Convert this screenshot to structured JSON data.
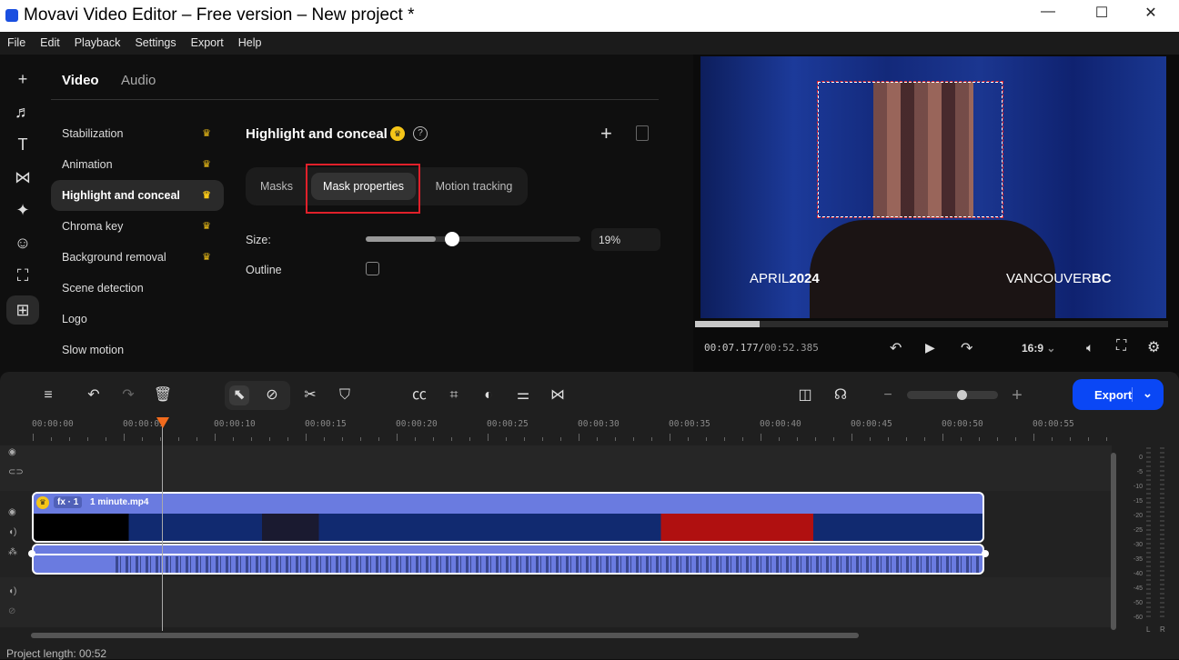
{
  "window": {
    "title": "Movavi Video Editor – Free version – New project *",
    "minimize": "—",
    "maximize": "☐",
    "close": "✕"
  },
  "menu": [
    "File",
    "Edit",
    "Playback",
    "Settings",
    "Export",
    "Help"
  ],
  "rail": [
    {
      "icon": "plus-icon",
      "g": "+"
    },
    {
      "icon": "music-icon",
      "g": "♬"
    },
    {
      "icon": "text-icon",
      "g": "T"
    },
    {
      "icon": "transitions-icon",
      "g": "⋈"
    },
    {
      "icon": "sparkle-icon",
      "g": "✦"
    },
    {
      "icon": "sticker-icon",
      "g": "☺"
    },
    {
      "icon": "store-icon",
      "g": "⛶"
    },
    {
      "icon": "more-tools-icon",
      "g": "⊞"
    }
  ],
  "tabs": {
    "video": "Video",
    "audio": "Audio"
  },
  "features": [
    {
      "label": "Stabilization",
      "premium": true
    },
    {
      "label": "Animation",
      "premium": true
    },
    {
      "label": "Highlight and conceal",
      "premium": true,
      "selected": true
    },
    {
      "label": "Chroma key",
      "premium": true
    },
    {
      "label": "Background removal",
      "premium": true
    },
    {
      "label": "Scene detection",
      "premium": false
    },
    {
      "label": "Logo",
      "premium": false
    },
    {
      "label": "Slow motion",
      "premium": false
    }
  ],
  "panel": {
    "title": "Highlight and conceal",
    "subtabs": [
      "Masks",
      "Mask properties",
      "Motion tracking"
    ],
    "active_subtab": "Mask properties",
    "size_label": "Size:",
    "size_value": "19%",
    "size_percent": 19,
    "outline_label": "Outline",
    "outline_checked": false,
    "highlight_color": "#e0202a"
  },
  "preview": {
    "left_caption_a": "APRIL",
    "left_caption_b": "2024",
    "right_caption_a": "VANCOUVER",
    "right_caption_b": "BC",
    "time_current": "00:07.177",
    "time_total": "00:52.385",
    "progress_fraction": 0.137,
    "aspect": "16:9"
  },
  "timeline": {
    "export_label": "Export",
    "ticks": [
      "00:00:00",
      "00:00:05",
      "00:00:10",
      "00:00:15",
      "00:00:20",
      "00:00:25",
      "00:00:30",
      "00:00:35",
      "00:00:40",
      "00:00:45",
      "00:00:50",
      "00:00:55"
    ],
    "clip_fx": "fx · 1",
    "clip_name": "1 minute.mp4",
    "project_length": "Project length: 00:52",
    "meter": [
      "0",
      "-5",
      "-10",
      "-15",
      "-20",
      "-25",
      "-30",
      "-35",
      "-40",
      "-45",
      "-50",
      "-60"
    ],
    "meter_lr": [
      "L",
      "R"
    ],
    "accent": "#0a47f5",
    "clip_color": "#6a7be0"
  }
}
